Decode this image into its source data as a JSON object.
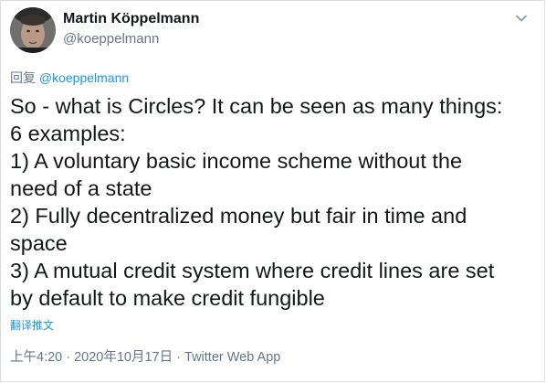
{
  "tweet": {
    "author_name": "Martin Köppelmann",
    "author_handle": "@koeppelmann",
    "reply_prefix": "回复",
    "reply_to": "@koeppelmann",
    "body_lines": [
      "So - what is Circles? It can be seen as many things:",
      "6 examples:",
      "1) A voluntary basic income scheme without the",
      "need of a state",
      "2) Fully decentralized money but fair in time and",
      "space",
      "3) A mutual credit system where credit lines are set",
      "by default to make credit fungible"
    ],
    "translate_label": "翻译推文",
    "timestamp": "上午4:20 · 2020年10月17日",
    "separator": " · ",
    "source": "Twitter Web App"
  },
  "icons": {
    "avatar": "profile-photo",
    "caret": "chevron-down-icon"
  },
  "colors": {
    "text_primary": "#14171a",
    "text_secondary": "#657786",
    "link": "#1b95e0",
    "border": "#d8dde2"
  }
}
